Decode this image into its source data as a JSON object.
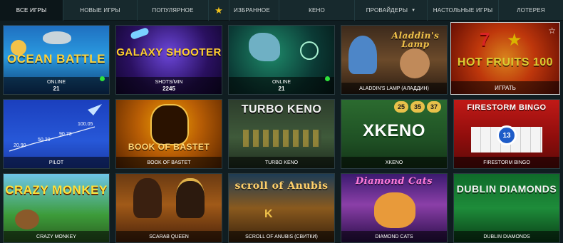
{
  "nav": {
    "items": [
      {
        "label": "ВСЕ ИГРЫ",
        "active": true
      },
      {
        "label": "НОВЫЕ ИГРЫ"
      },
      {
        "label": "ПОПУЛЯРНОЕ"
      },
      {
        "label": "ИЗБРАННОЕ",
        "icon": "star-icon"
      },
      {
        "label": "КЕНО"
      },
      {
        "label": "ПРОВАЙДЕРЫ",
        "icon": "caret-down-icon"
      },
      {
        "label": "НАСТОЛЬНЫЕ ИГРЫ"
      },
      {
        "label": "ЛОТЕРЕЯ"
      }
    ]
  },
  "games": [
    {
      "logo": "OCEAN BATTLE",
      "caption_label": "ONLINE",
      "caption_value": "21",
      "status_dot": "#2ee23b"
    },
    {
      "logo": "GALAXY SHOOTER",
      "caption_label": "SHOTS/MIN",
      "caption_value": "2245"
    },
    {
      "logo": "",
      "caption_label": "ONLINE",
      "caption_value": "21",
      "status_dot": "#2ee23b"
    },
    {
      "logo": "Aladdin's Lamp",
      "caption_label": "ALADDIN'S LAMP (АЛАДДИН)"
    },
    {
      "logo": "HOT FRUITS 100",
      "caption_label": "ИГРАТЬ",
      "favorite_icon": "star-outline-icon"
    },
    {
      "logo": "",
      "caption_label": "PILOT",
      "chart_points": [
        "20.90",
        "50.20",
        "90.73",
        "100.05"
      ]
    },
    {
      "logo": "BOOK OF BASTET",
      "caption_label": "BOOK OF BASTET"
    },
    {
      "logo": "TURBO KENO",
      "caption_label": "TURBO KENO"
    },
    {
      "logo": "XKENO",
      "caption_label": "XKENO",
      "balls": [
        "25",
        "35",
        "37"
      ]
    },
    {
      "logo": "FIRESTORM BINGO",
      "caption_label": "FIRESTORM BINGO",
      "ball": "13"
    },
    {
      "logo": "CRAZY MONKEY",
      "caption_label": "CRAZY MONKEY"
    },
    {
      "logo": "",
      "caption_label": "SCARAB QUEEN"
    },
    {
      "logo": "scroll of Anubis",
      "caption_label": "SCROLL OF ANUBIS (СВИТКИ)"
    },
    {
      "logo": "Diamond Cats",
      "caption_label": "DIAMOND CATS"
    },
    {
      "logo": "DUBLIN DIAMONDS",
      "caption_label": "DUBLIN DIAMONDS"
    }
  ]
}
